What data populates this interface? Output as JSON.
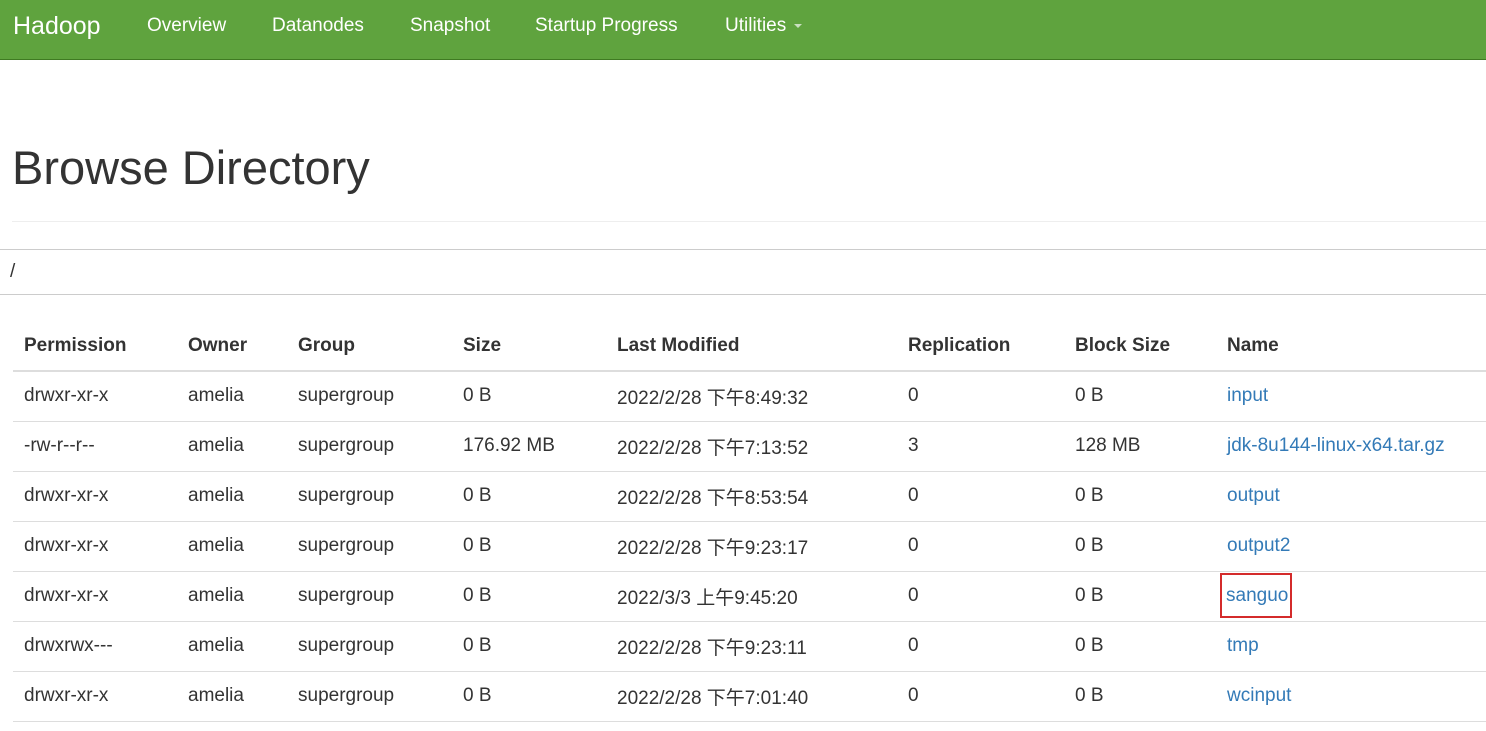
{
  "navbar": {
    "brand": "Hadoop",
    "items": [
      {
        "label": "Overview"
      },
      {
        "label": "Datanodes"
      },
      {
        "label": "Snapshot"
      },
      {
        "label": "Startup Progress"
      },
      {
        "label": "Utilities"
      }
    ],
    "background_color": "#5fa33e"
  },
  "page": {
    "title": "Browse Directory",
    "path": "/"
  },
  "table": {
    "headers": [
      "Permission",
      "Owner",
      "Group",
      "Size",
      "Last Modified",
      "Replication",
      "Block Size",
      "Name"
    ],
    "rows": [
      {
        "permission": "drwxr-xr-x",
        "owner": "amelia",
        "group": "supergroup",
        "size": "0 B",
        "last_modified": "2022/2/28 下午8:49:32",
        "replication": "0",
        "block_size": "0 B",
        "name": "input"
      },
      {
        "permission": "-rw-r--r--",
        "owner": "amelia",
        "group": "supergroup",
        "size": "176.92 MB",
        "last_modified": "2022/2/28 下午7:13:52",
        "replication": "3",
        "block_size": "128 MB",
        "name": "jdk-8u144-linux-x64.tar.gz"
      },
      {
        "permission": "drwxr-xr-x",
        "owner": "amelia",
        "group": "supergroup",
        "size": "0 B",
        "last_modified": "2022/2/28 下午8:53:54",
        "replication": "0",
        "block_size": "0 B",
        "name": "output"
      },
      {
        "permission": "drwxr-xr-x",
        "owner": "amelia",
        "group": "supergroup",
        "size": "0 B",
        "last_modified": "2022/2/28 下午9:23:17",
        "replication": "0",
        "block_size": "0 B",
        "name": "output2"
      },
      {
        "permission": "drwxr-xr-x",
        "owner": "amelia",
        "group": "supergroup",
        "size": "0 B",
        "last_modified": "2022/3/3 上午9:45:20",
        "replication": "0",
        "block_size": "0 B",
        "name": "sanguo",
        "highlighted": true
      },
      {
        "permission": "drwxrwx---",
        "owner": "amelia",
        "group": "supergroup",
        "size": "0 B",
        "last_modified": "2022/2/28 下午9:23:11",
        "replication": "0",
        "block_size": "0 B",
        "name": "tmp"
      },
      {
        "permission": "drwxr-xr-x",
        "owner": "amelia",
        "group": "supergroup",
        "size": "0 B",
        "last_modified": "2022/2/28 下午7:01:40",
        "replication": "0",
        "block_size": "0 B",
        "name": "wcinput"
      }
    ],
    "link_color": "#337ab7",
    "highlight_color": "#d42b2b"
  }
}
